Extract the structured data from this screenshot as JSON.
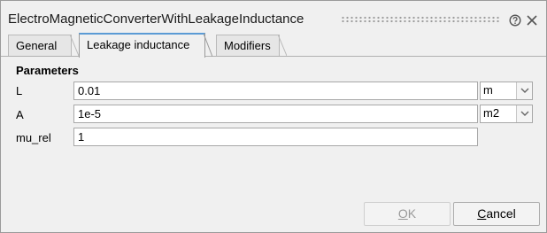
{
  "window": {
    "title": "ElectroMagneticConverterWithLeakageInductance"
  },
  "icons": {
    "help": "help-icon",
    "close": "close-icon",
    "dropdown": "chevron-down-icon"
  },
  "tabs": [
    {
      "label": "General",
      "active": false
    },
    {
      "label": "Leakage inductance",
      "active": true
    },
    {
      "label": "Modifiers",
      "active": false
    }
  ],
  "parameters": {
    "heading": "Parameters",
    "rows": [
      {
        "label": "L",
        "value": "0.01",
        "unit": "m"
      },
      {
        "label": "A",
        "value": "1e-5",
        "unit": "m2"
      },
      {
        "label": "mu_rel",
        "value": "1",
        "unit": ""
      }
    ]
  },
  "buttons": {
    "ok": {
      "mnemonic": "O",
      "rest": "K",
      "enabled": false
    },
    "cancel": {
      "mnemonic": "C",
      "rest": "ancel",
      "enabled": true
    }
  },
  "colors": {
    "active_tab_accent": "#5b9bd5",
    "background": "#f0f0f0"
  }
}
